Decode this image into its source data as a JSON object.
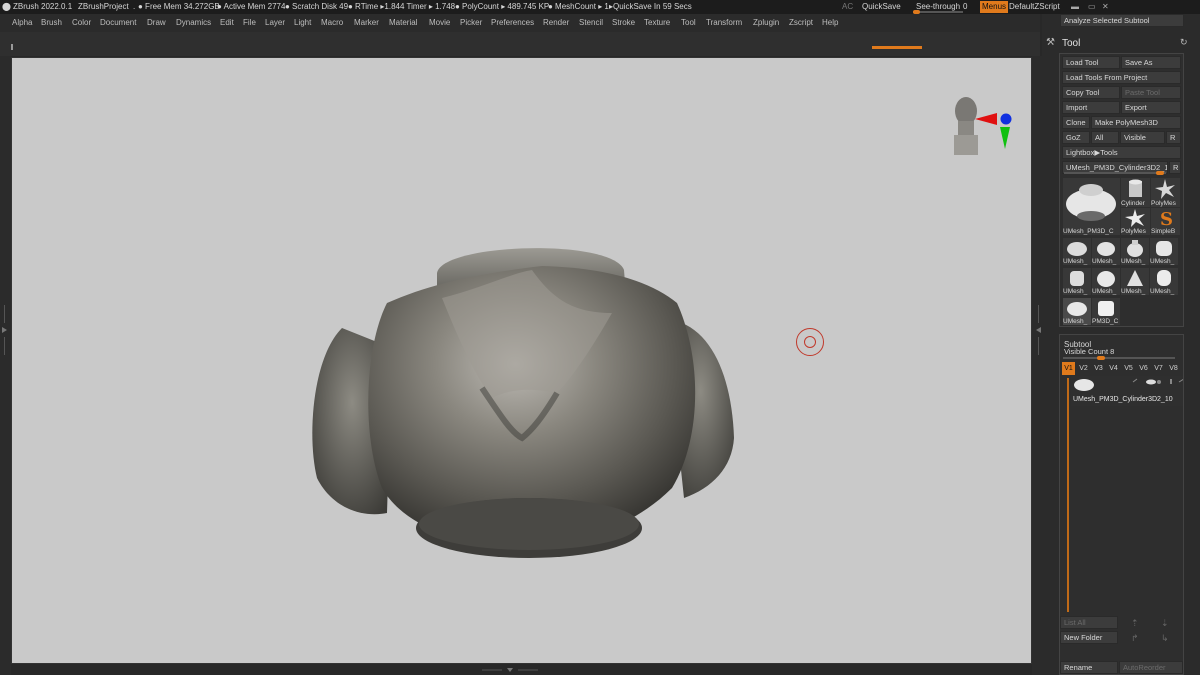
{
  "titlebar": {
    "app": "ZBrush 2022.0.1",
    "project": "ZBrushProject",
    "dot": ".",
    "free_mem": "● Free Mem 34.272GB",
    "active_mem": "● Active Mem 2774",
    "scratch": "● Scratch Disk 49",
    "rtime": "● RTime ▸1.844 Timer ▸ 1.748",
    "polycount": "● PolyCount ▸ 489.745 KP",
    "meshcount": "● MeshCount ▸ 1",
    "quicksave_in": "▸QuickSave In 59 Secs",
    "ac": "AC",
    "quicksave": "QuickSave",
    "seethrough": "See-through",
    "seethrough_val": "0",
    "seethrough_value": 0.12,
    "menus": "Menus",
    "script": "DefaultZScript"
  },
  "menubar": {
    "items": [
      "Alpha",
      "Brush",
      "Color",
      "Document",
      "Draw",
      "Dynamics",
      "Edit",
      "File",
      "Layer",
      "Light",
      "Macro",
      "Marker",
      "Material",
      "Movie",
      "Picker",
      "Preferences",
      "Render",
      "Stencil",
      "Stroke",
      "Texture",
      "Tool",
      "Transform",
      "Zplugin",
      "Zscript",
      "Help"
    ]
  },
  "tray": {
    "analyze": "Analyze Selected Subtool",
    "tool_title": "Tool",
    "tool_icon": "hammer-icon",
    "reset_icon": "reset-icon",
    "buttons": {
      "load_tool": "Load Tool",
      "save_as": "Save As",
      "load_from_project": "Load Tools From Project",
      "copy_tool": "Copy Tool",
      "paste_tool": "Paste Tool",
      "import": "Import",
      "export": "Export",
      "clone": "Clone",
      "make_polymesh": "Make PolyMesh3D",
      "goz": "GoZ",
      "all": "All",
      "visible": "Visible",
      "r": "R",
      "lightbox_tools": "Lightbox▶Tools"
    },
    "current_tool": "UMesh_PM3D_Cylinder3D2_1",
    "current_tool_r": "R",
    "current_tool_slider": 0.9,
    "thumbs": {
      "main": "UMesh_PM3D_C",
      "cylinder": "Cylinder",
      "polymesh1": "PolyMes",
      "polymesh2": "PolyMes",
      "simpleb": "SimpleB",
      "u1": "UMesh_",
      "u2": "UMesh_",
      "u3": "UMesh_",
      "u4": "UMesh_",
      "u5": "UMesh_",
      "u6": "UMesh_",
      "u7": "UMesh_",
      "u8": "UMesh_",
      "u9": "UMesh_",
      "pm3d": "PM3D_C"
    },
    "subtool": {
      "title": "Subtool",
      "visible_count": "Visible Count 8",
      "visible_count_slider": 0.35,
      "versions": [
        "V1",
        "V2",
        "V3",
        "V4",
        "V5",
        "V6",
        "V7",
        "V8"
      ],
      "item_name": "UMesh_PM3D_Cylinder3D2_10",
      "list_all": "List All",
      "new_folder": "New Folder",
      "rename": "Rename",
      "autoreorder": "AutoReorder"
    }
  },
  "colors": {
    "accent": "#e07a1c",
    "viewport_bg": "#c9c9c9",
    "panel_bg": "#2b2b2b",
    "button_bg": "#3c3c3c",
    "axis_red": "#e01010",
    "axis_green": "#10c010",
    "axis_blue": "#1030e0"
  }
}
